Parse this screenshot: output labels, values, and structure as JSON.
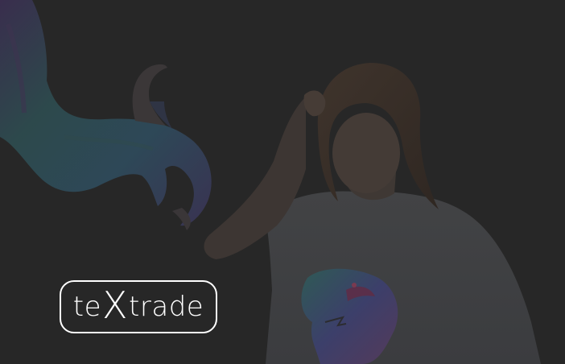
{
  "brand": {
    "logo": {
      "part_before": "te",
      "part_accent": "X",
      "part_after": "trade"
    },
    "colors": {
      "background": "#272727",
      "logo": "#ffffff"
    }
  },
  "scene": {
    "icons": [
      "dinosaur-claw-artwork",
      "model-with-dino-tshirt-photo"
    ]
  }
}
